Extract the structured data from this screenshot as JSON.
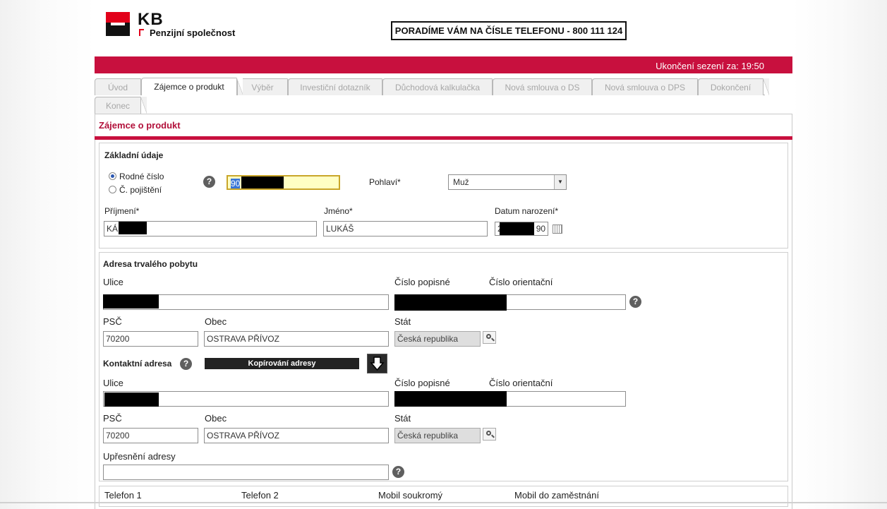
{
  "header": {
    "logo_text": "KB",
    "logo_subtitle": "Penzijní společnost",
    "phone_banner": "PORADÍME VÁM NA ČÍSLE TELEFONU - 800 111 124",
    "session_timer": "Ukončení sezení za: 19:50"
  },
  "tabs": [
    {
      "label": "Úvod",
      "active": false
    },
    {
      "label": "Zájemce o produkt",
      "active": true
    },
    {
      "label": "Výběr",
      "active": false
    },
    {
      "label": "Investiční dotazník",
      "active": false
    },
    {
      "label": "Důchodová kalkulačka",
      "active": false
    },
    {
      "label": "Nová smlouva o DS",
      "active": false
    },
    {
      "label": "Nová smlouva o DPS",
      "active": false
    },
    {
      "label": "Dokončení",
      "active": false
    },
    {
      "label": "Konec",
      "active": false
    }
  ],
  "page_title": "Zájemce o produkt",
  "basic": {
    "section_title": "Základní údaje",
    "radio_rodne": "Rodné číslo",
    "radio_pojisteni": "Č. pojištění",
    "id_value": "90",
    "gender_label": "Pohlaví*",
    "gender_value": "Muž",
    "surname_label": "Příjmení*",
    "surname_value": "KÁ",
    "firstname_label": "Jméno*",
    "firstname_value": "LUKÁŠ",
    "dob_label": "Datum narození*",
    "dob_prefix": "2",
    "dob_suffix": "90"
  },
  "permanent": {
    "section_title": "Adresa trvalého pobytu",
    "street_label": "Ulice",
    "house_label": "Číslo popisné",
    "orient_label": "Číslo orientační",
    "psc_label": "PSČ",
    "psc_value": "70200",
    "city_label": "Obec",
    "city_value": "OSTRAVA PŘÍVOZ",
    "country_label": "Stát",
    "country_value": "Česká republika"
  },
  "contact": {
    "section_title": "Kontaktní adresa",
    "copy_label": "Kopírování adresy",
    "street_label": "Ulice",
    "house_label": "Číslo popisné",
    "orient_label": "Číslo orientační",
    "psc_label": "PSČ",
    "psc_value": "70200",
    "city_label": "Obec",
    "city_value": "OSTRAVA PŘÍVOZ",
    "country_label": "Stát",
    "country_value": "Česká republika",
    "detail_label": "Upřesnění adresy"
  },
  "phones": {
    "phone1": "Telefon 1",
    "phone2": "Telefon 2",
    "mobile_private": "Mobil soukromý",
    "mobile_work": "Mobil do zaměstnání"
  },
  "help_glyph": "?"
}
